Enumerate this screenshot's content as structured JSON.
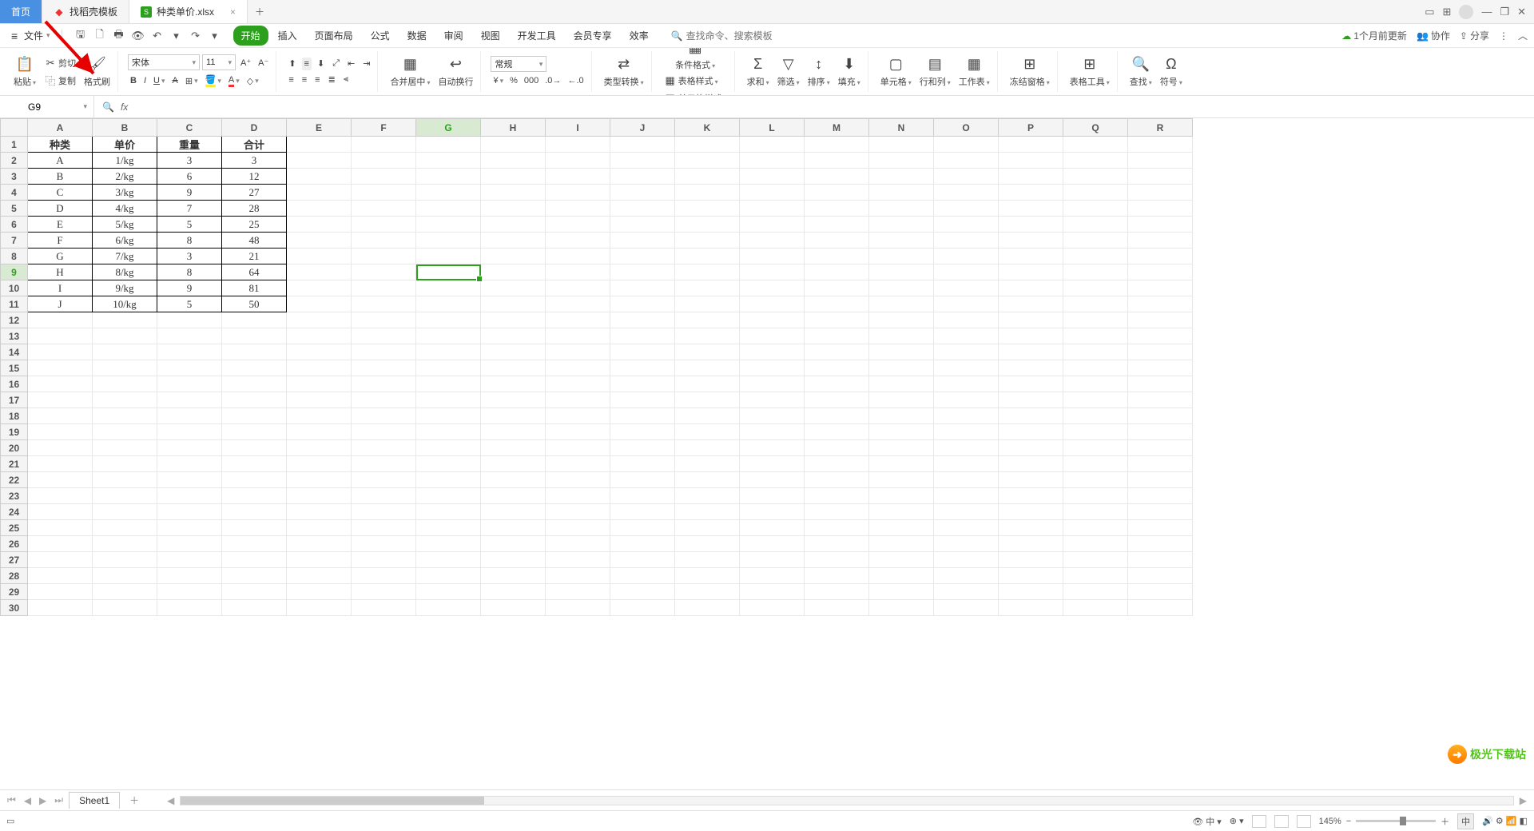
{
  "tabs": {
    "home": "首页",
    "template": "找稻壳模板",
    "file": "种类单价.xlsx"
  },
  "menu": {
    "file_label": "文件",
    "items": [
      "开始",
      "插入",
      "页面布局",
      "公式",
      "数据",
      "审阅",
      "视图",
      "开发工具",
      "会员专享",
      "效率"
    ],
    "active": 0,
    "search_placeholder": "查找命令、搜索模板"
  },
  "top_right": {
    "update": "1个月前更新",
    "coop": "协作",
    "share": "分享"
  },
  "ribbon": {
    "paste": "粘贴",
    "cut": "剪切",
    "copy": "复制",
    "format_painter": "格式刷",
    "font_name": "宋体",
    "font_size": "11",
    "number_format": "常规",
    "merge": "合并居中",
    "wrap": "自动换行",
    "type_convert": "类型转换",
    "cond_format": "条件格式",
    "table_style": "表格样式",
    "cell_style": "单元格样式",
    "sum": "求和",
    "filter": "筛选",
    "sort": "排序",
    "fill": "填充",
    "cell": "单元格",
    "rowcol": "行和列",
    "worksheet": "工作表",
    "freeze": "冻结窗格",
    "table_tools": "表格工具",
    "find": "查找",
    "symbol": "符号"
  },
  "namebox": "G9",
  "columns": [
    "A",
    "B",
    "C",
    "D",
    "E",
    "F",
    "G",
    "H",
    "I",
    "J",
    "K",
    "L",
    "M",
    "N",
    "O",
    "P",
    "Q",
    "R"
  ],
  "row_count": 30,
  "selected": {
    "col": "G",
    "row": 9
  },
  "data": {
    "headers": [
      "种类",
      "单价",
      "重量",
      "合计"
    ],
    "rows": [
      [
        "A",
        "1/kg",
        "3",
        "3"
      ],
      [
        "B",
        "2/kg",
        "6",
        "12"
      ],
      [
        "C",
        "3/kg",
        "9",
        "27"
      ],
      [
        "D",
        "4/kg",
        "7",
        "28"
      ],
      [
        "E",
        "5/kg",
        "5",
        "25"
      ],
      [
        "F",
        "6/kg",
        "8",
        "48"
      ],
      [
        "G",
        "7/kg",
        "3",
        "21"
      ],
      [
        "H",
        "8/kg",
        "8",
        "64"
      ],
      [
        "I",
        "9/kg",
        "9",
        "81"
      ],
      [
        "J",
        "10/kg",
        "5",
        "50"
      ]
    ]
  },
  "sheet_tab": "Sheet1",
  "zoom": "145%",
  "status_icons": {
    "eye": "◉",
    "grid": "中"
  },
  "watermark": "极光下载站",
  "ime_badge": "中"
}
